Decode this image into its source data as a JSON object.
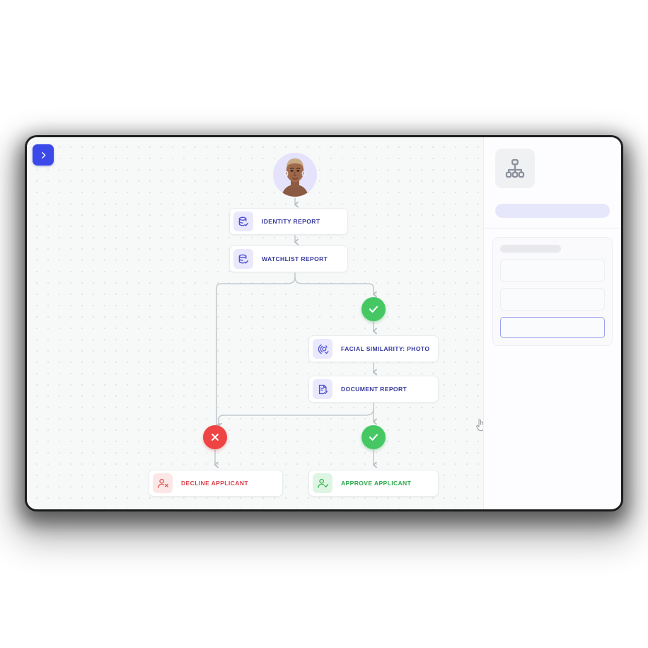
{
  "window": {
    "name": "workflow-builder"
  },
  "toolbar": {
    "collapse_label": "›",
    "collapse_icon": "chevron-right-icon"
  },
  "canvas": {
    "applicant": {
      "name": "applicant-avatar",
      "icon": "person-photo-avatar"
    },
    "nodes": [
      {
        "id": "identity",
        "label": "IDENTITY REPORT",
        "icon": "database-check-icon",
        "kind": "report"
      },
      {
        "id": "watchlist",
        "label": "WATCHLIST REPORT",
        "icon": "database-check-icon",
        "kind": "report"
      },
      {
        "id": "facial",
        "label": "FACIAL SIMILARITY: PHOTO",
        "icon": "face-scan-icon",
        "kind": "report"
      },
      {
        "id": "document",
        "label": "DOCUMENT REPORT",
        "icon": "document-check-icon",
        "kind": "report"
      },
      {
        "id": "decline",
        "label": "DECLINE APPLICANT",
        "icon": "person-remove-icon",
        "kind": "decline"
      },
      {
        "id": "approve",
        "label": "APPROVE APPLICANT",
        "icon": "person-check-icon",
        "kind": "approve"
      }
    ],
    "badges": [
      {
        "id": "pass-1",
        "icon": "check-circle-icon",
        "state": "pass"
      },
      {
        "id": "fail",
        "icon": "cross-circle-icon",
        "state": "fail"
      },
      {
        "id": "pass-2",
        "icon": "check-circle-icon",
        "state": "pass"
      }
    ],
    "pointer": {
      "icon": "hand-cursor-icon"
    }
  },
  "side_panel": {
    "type_icon": "org-chart-icon",
    "title_placeholder": "",
    "field_label_placeholder": "",
    "inputs": [
      {
        "id": "input-1",
        "value": "",
        "focused": false
      },
      {
        "id": "input-2",
        "value": "",
        "focused": false
      },
      {
        "id": "input-3",
        "value": "",
        "focused": true
      }
    ]
  },
  "colors": {
    "accent_blue": "#3b49e8",
    "node_text": "#383a9e",
    "pass_green": "#45c863",
    "fail_red": "#ee4444",
    "decline_text": "#d9404b",
    "approve_text": "#2aa84a",
    "canvas_bg": "#f7f9f8",
    "panel_bg": "#fdfdff"
  }
}
